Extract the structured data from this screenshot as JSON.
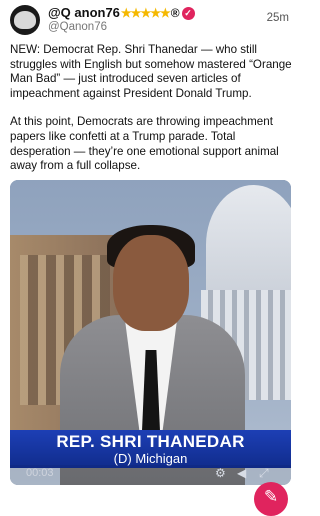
{
  "post": {
    "display_name": "@Q anon76",
    "badge_stars": "★★★★★",
    "badge_registered": "®",
    "verified_icon": "check-badge-icon",
    "handle": "@Qanon76",
    "timestamp": "25m",
    "paragraphs": [
      "NEW: Democrat Rep. Shri Thanedar — who still struggles with English but somehow mastered “Orange Man Bad” — just introduced seven articles of impeachment against President Donald Trump.",
      "At this point, Democrats are throwing impeachment papers like confetti at a Trump parade. Total desperation — they’re one emotional support animal away from a full collapse."
    ]
  },
  "video": {
    "lower_third_name": "REP. SHRI THANEDAR",
    "lower_third_sub": "(D) Michigan",
    "time": "00:03",
    "icons": [
      "settings-icon",
      "volume-icon",
      "fullscreen-icon"
    ]
  },
  "colors": {
    "accent": "#e0245e",
    "star": "#f5b800",
    "lower_third_blue": "#1d3fb5"
  },
  "fab": {
    "icon": "compose-icon"
  }
}
